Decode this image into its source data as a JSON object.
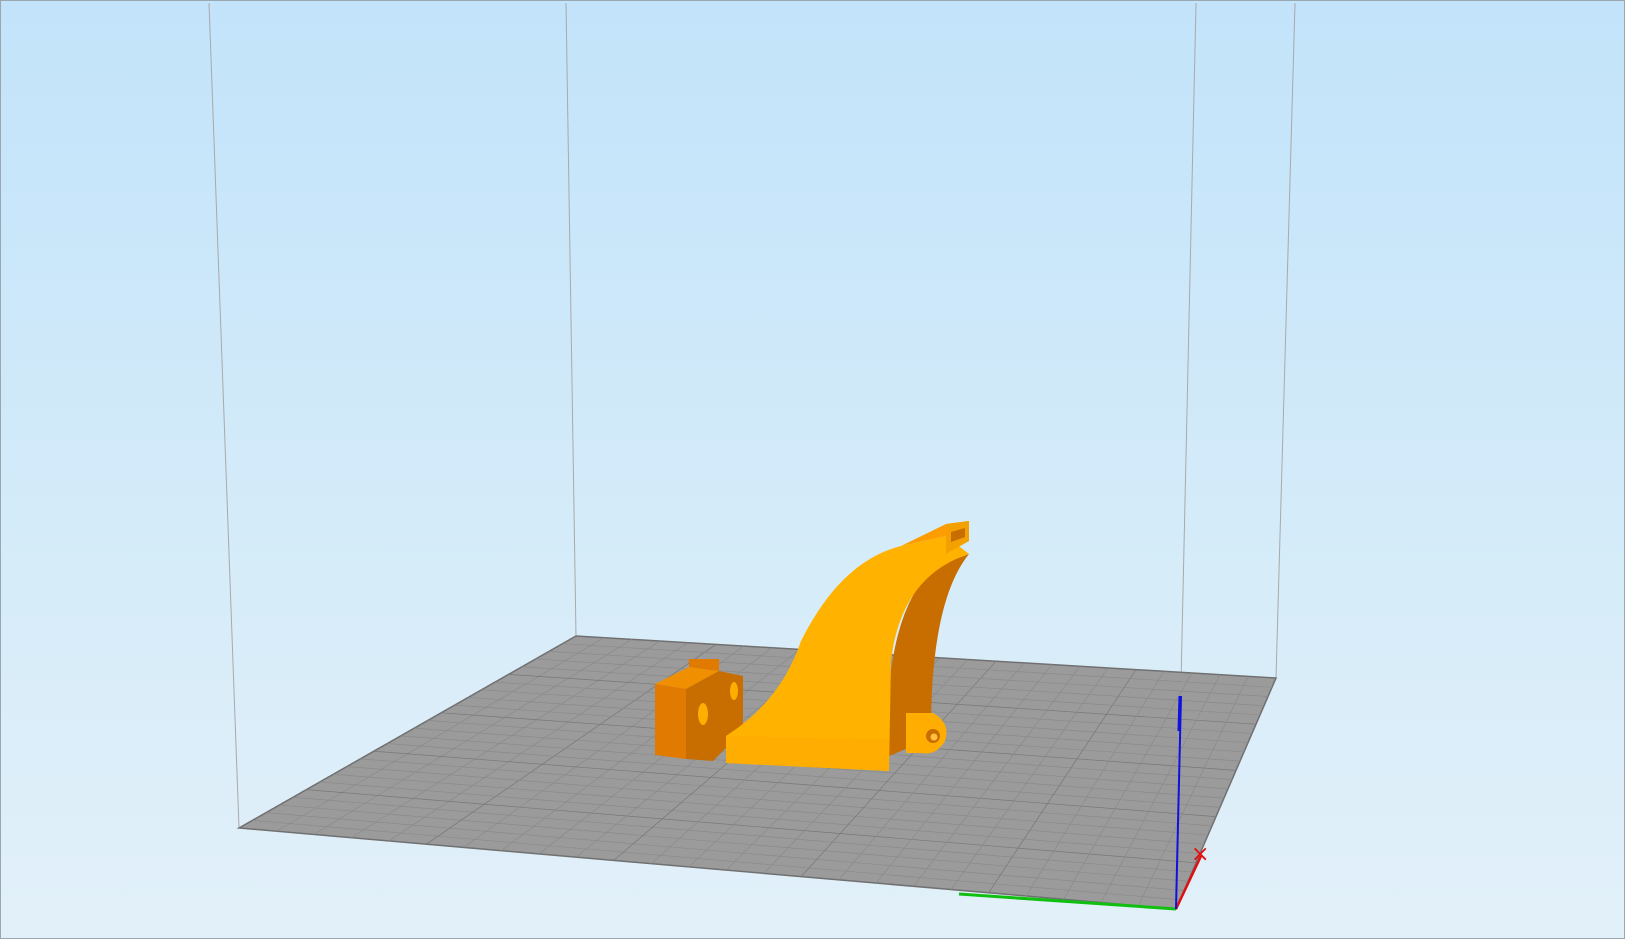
{
  "viewport": {
    "type": "3d-print-preview",
    "background_top": "#c2e3fa",
    "background_bottom": "#e2f0f9",
    "build_plate_color": "#9b9b9b",
    "grid_color": "#8a8a8a",
    "volume_edge_color": "#a9a9a9"
  },
  "model": {
    "color": "#ffad00",
    "shade_color": "#c86e00",
    "dark_color": "#e07a00"
  },
  "axes": {
    "x_color": "#e01010",
    "y_color": "#10c010",
    "z_color": "#1010e0"
  }
}
